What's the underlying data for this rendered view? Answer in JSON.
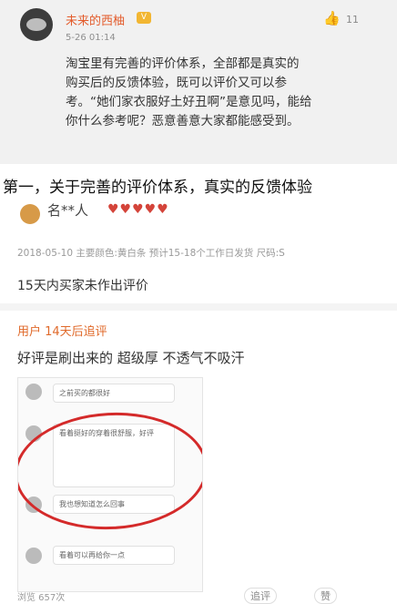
{
  "comment_card": {
    "username": "未来的西柚",
    "badge": "V",
    "timestamp": "5-26 01:14",
    "like_icon": "thumbs-up-icon",
    "like_count": "11",
    "lines": [
      "淘宝里有完善的评价体系，全部都是真实的",
      "购买后的反馈体验，既可以评价又可以参",
      "考。“她们家衣服好土好丑啊”是意见吗，能给",
      "你什么参考呢？恶意善意大家都能感受到。"
    ]
  },
  "heading": "第一，关于完善的评价体系，真实的反馈体验",
  "review": {
    "partial_name": "名**人",
    "stars": "♥♥♥♥♥",
    "meta": "2018-05-10 主要颜色:黄白条 预计15-18个工作日发货 尺码:S",
    "text": "15天内买家未作出评价",
    "followup_label": "用户 14天后追评",
    "followup_text": "好评是刷出来的 超级厚 不透气不吸汗",
    "screenshot_bubbles": [
      "之前买的都很好",
      "看着挺好的穿着很舒服，好评",
      "我也想知道怎么回事",
      "看着可以再给你一点"
    ],
    "footer_views": "浏览 657次",
    "footer_action_1": "追评",
    "footer_action_2": "赞"
  }
}
